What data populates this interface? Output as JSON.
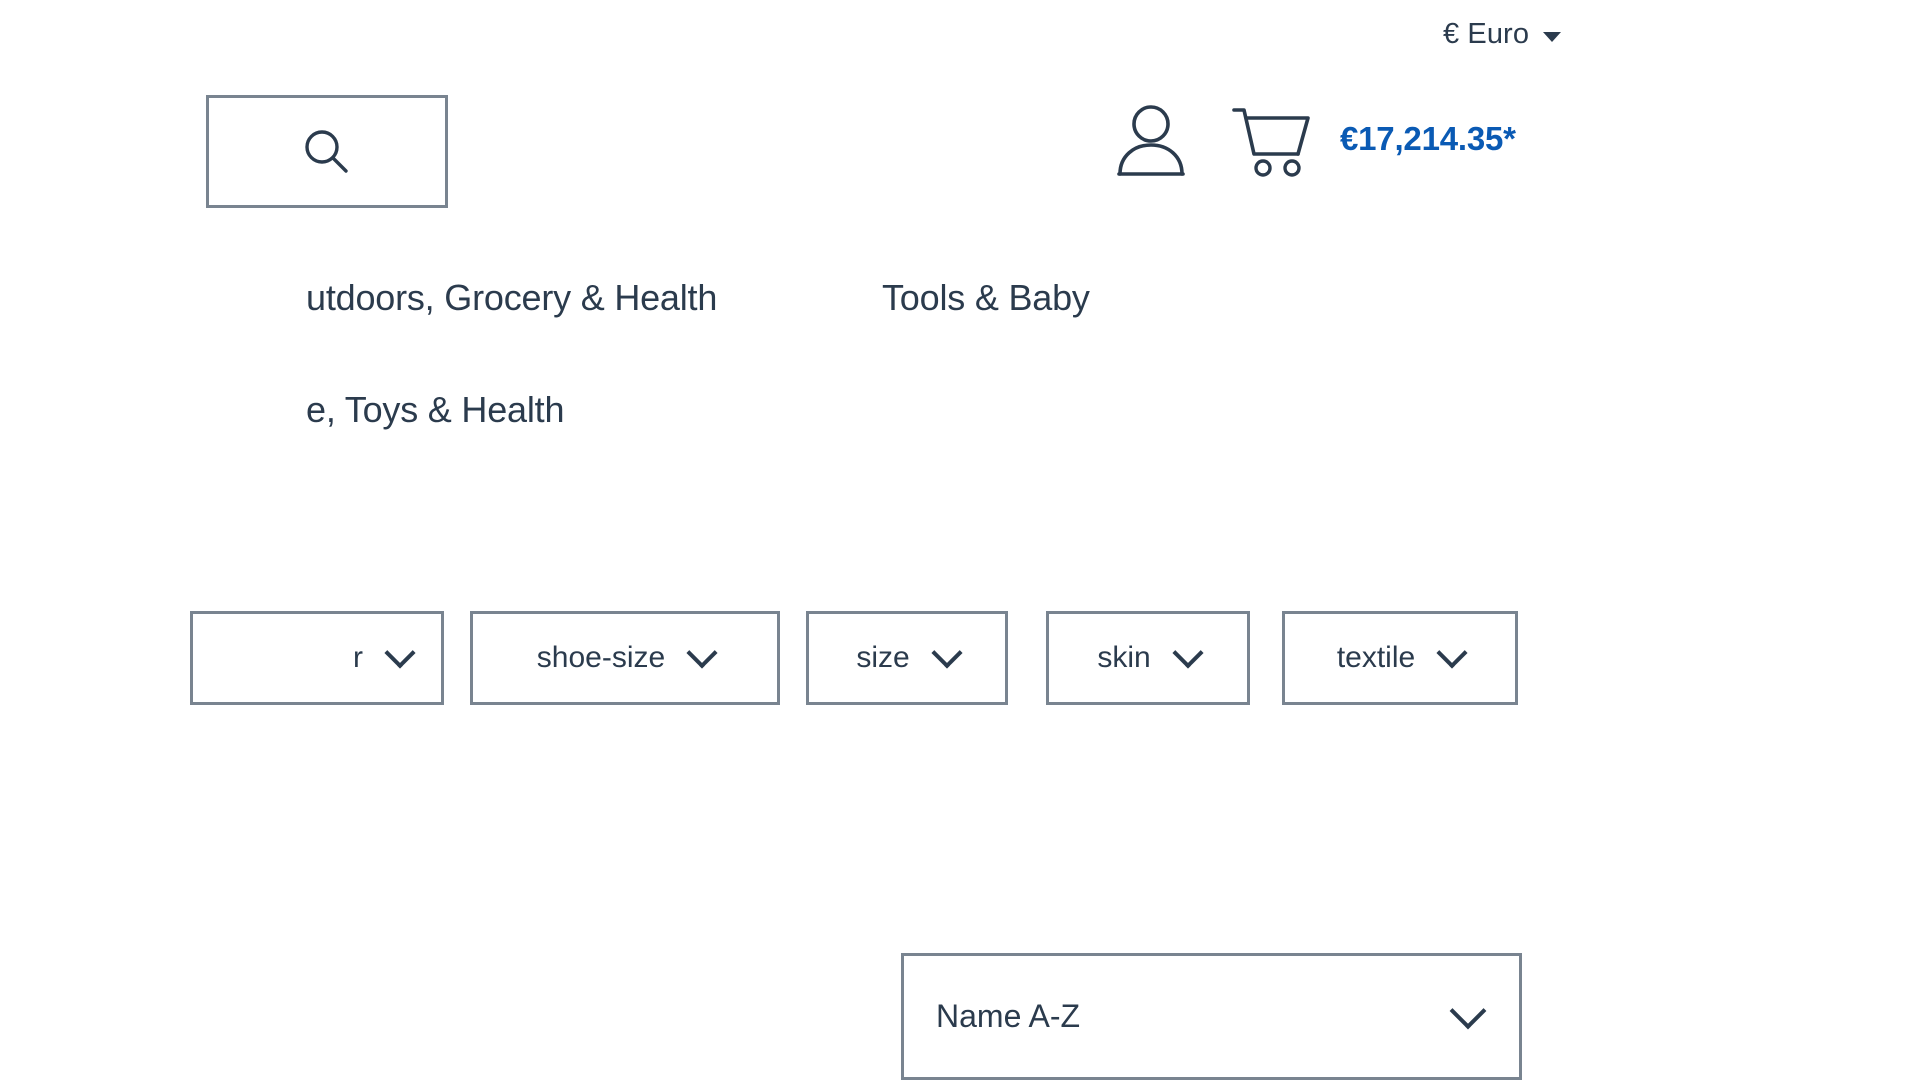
{
  "topbar": {
    "currency": {
      "symbol": "€",
      "label": "€ Euro",
      "icon": "chevron-down-icon"
    }
  },
  "header": {
    "search": {
      "icon": "search-icon",
      "placeholder": "",
      "value": ""
    },
    "account": {
      "icon": "user-icon",
      "label": ""
    },
    "cart": {
      "icon": "shopping-cart-icon",
      "total": "€17,214.35*",
      "total_color": "#0a5ab4"
    }
  },
  "navigation": {
    "rows": [
      {
        "items": [
          {
            "label": "utdoors, Grocery & Health",
            "clipped": true
          },
          {
            "label": "Tools & Baby",
            "clipped": false
          }
        ]
      },
      {
        "items": [
          {
            "label": "e, Toys & Health",
            "clipped": true
          }
        ]
      }
    ]
  },
  "filters": {
    "items": [
      {
        "label": "r",
        "icon": "chevron-down-icon",
        "clipped": true
      },
      {
        "label": "shoe-size",
        "icon": "chevron-down-icon",
        "clipped": false
      },
      {
        "label": "size",
        "icon": "chevron-down-icon",
        "clipped": false
      },
      {
        "label": "skin",
        "icon": "chevron-down-icon",
        "clipped": false
      },
      {
        "label": "textile",
        "icon": "chevron-down-icon",
        "clipped": false
      }
    ]
  },
  "sorting": {
    "selected": "Name A-Z",
    "icon": "chevron-down-icon"
  },
  "colors": {
    "text": "#2b3b4d",
    "accent": "#0a5ab4",
    "border": "#798490",
    "background": "#ffffff"
  }
}
